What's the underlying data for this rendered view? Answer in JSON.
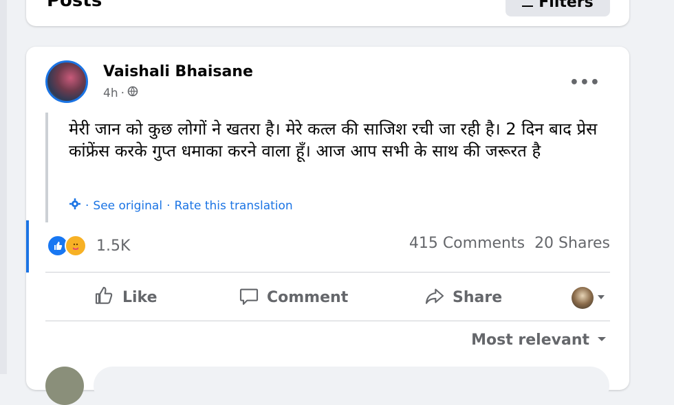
{
  "posts_header": {
    "title": "Posts",
    "filters_label": "Filters"
  },
  "post": {
    "author": "Vaishali Bhaisane",
    "time": "4h",
    "privacy_icon": "globe-icon",
    "body": "मेरी जान को कुछ लोगों ने खतरा है। मेरे कत्ल की साजिश रची जा रही है। 2 दिन बाद प्रेस कांफ्रेंस करके गुप्त धमाका करने वाला हूँ। आज आप सभी के साथ की जरूरत है",
    "see_original": "See original",
    "rate_translation": "Rate this translation",
    "reactions_count": "1.5K",
    "comments": "415 Comments",
    "shares": "20 Shares",
    "actions": {
      "like": "Like",
      "comment": "Comment",
      "share": "Share"
    },
    "sort_label": "Most relevant"
  },
  "colors": {
    "accent": "#1b74e4",
    "secondary_text": "#65676b",
    "like_reaction": "#1877f2",
    "care_reaction": "#f7b125"
  }
}
